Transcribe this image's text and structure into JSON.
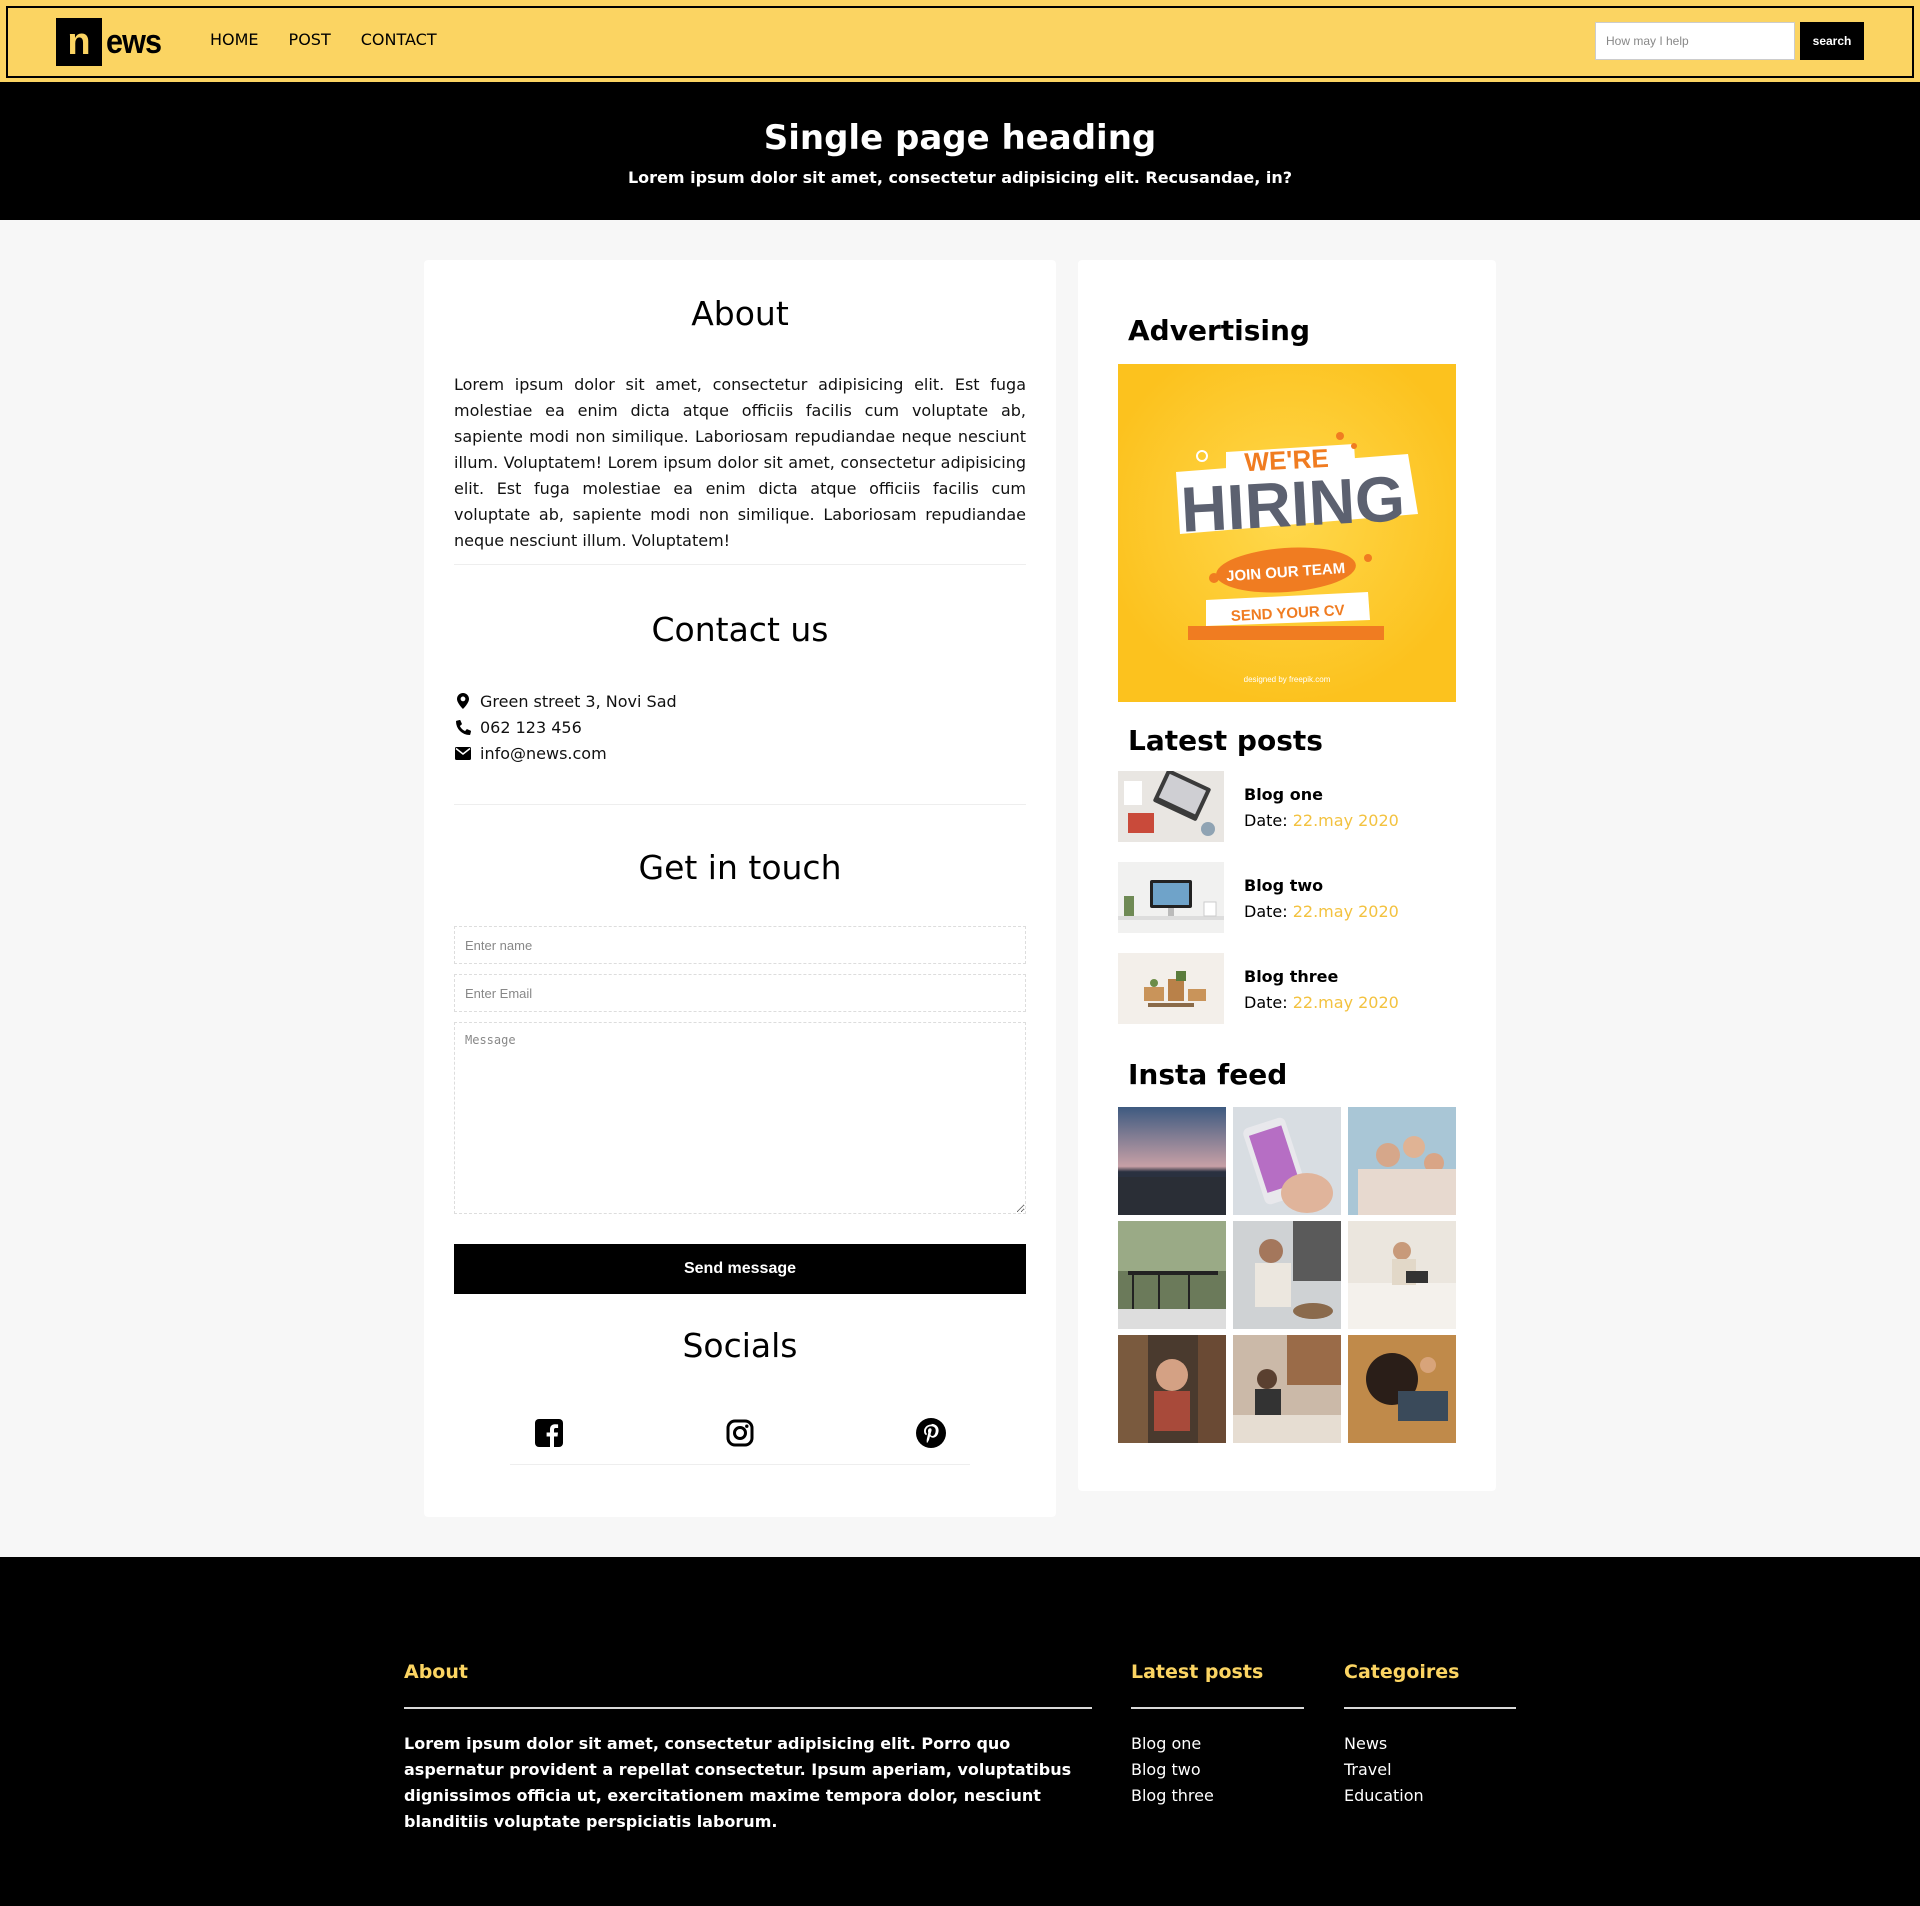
{
  "navbar": {
    "logo_initial": "n",
    "logo_rest": "ews",
    "links": [
      "HOME",
      "POST",
      "CONTACT"
    ],
    "search_placeholder": "How may I help",
    "search_button": "search",
    "accent_color": "#fbd462"
  },
  "hero": {
    "title": "Single page heading",
    "subtitle": "Lorem ipsum dolor sit amet, consectetur adipisicing elit. Recusandae, in?"
  },
  "about": {
    "title": "About",
    "text": "Lorem ipsum dolor sit amet, consectetur adipisicing elit. Est fuga molestiae ea enim dicta atque officiis facilis cum voluptate ab, sapiente modi non similique. Laboriosam repudiandae neque nesciunt illum. Voluptatem! Lorem ipsum dolor sit amet, consectetur adipisicing elit. Est fuga molestiae ea enim dicta atque officiis facilis cum voluptate ab, sapiente modi non similique. Laboriosam repudiandae neque nesciunt illum. Voluptatem!"
  },
  "contact": {
    "title": "Contact us",
    "address": "Green street 3, Novi Sad",
    "phone": "062 123 456",
    "email": "info@news.com"
  },
  "get_in_touch": {
    "title": "Get in touch",
    "name_placeholder": "Enter name",
    "email_placeholder": "Enter Email",
    "message_placeholder": "Message",
    "send_label": "Send message"
  },
  "socials": {
    "title": "Socials",
    "icons": [
      "facebook-icon",
      "instagram-icon",
      "pinterest-icon"
    ]
  },
  "sidebar": {
    "advertising_title": "Advertising",
    "ad": {
      "line1": "WE'RE",
      "line2": "HIRING",
      "line3": "JOIN OUR TEAM",
      "line4": "SEND YOUR CV",
      "credit": "designed by freepik.com"
    },
    "latest_title": "Latest posts",
    "posts": [
      {
        "title": "Blog one",
        "date_label": "Date:",
        "date": "22.may 2020"
      },
      {
        "title": "Blog two",
        "date_label": "Date:",
        "date": "22.may 2020"
      },
      {
        "title": "Blog three",
        "date_label": "Date:",
        "date": "22.may 2020"
      }
    ],
    "insta_title": "Insta feed"
  },
  "footer": {
    "about_title": "About",
    "about_text": "Lorem ipsum dolor sit amet, consectetur adipisicing elit. Porro quo aspernatur provident a repellat consectetur. Ipsum aperiam, voluptatibus dignissimos officia ut, exercitationem maxime tempora dolor, nesciunt blanditiis voluptate perspiciatis laborum.",
    "latest_title": "Latest posts",
    "latest_items": [
      "Blog one",
      "Blog two",
      "Blog three"
    ],
    "categories_title": "Categoires",
    "categories": [
      "News",
      "Travel",
      "Education"
    ]
  }
}
